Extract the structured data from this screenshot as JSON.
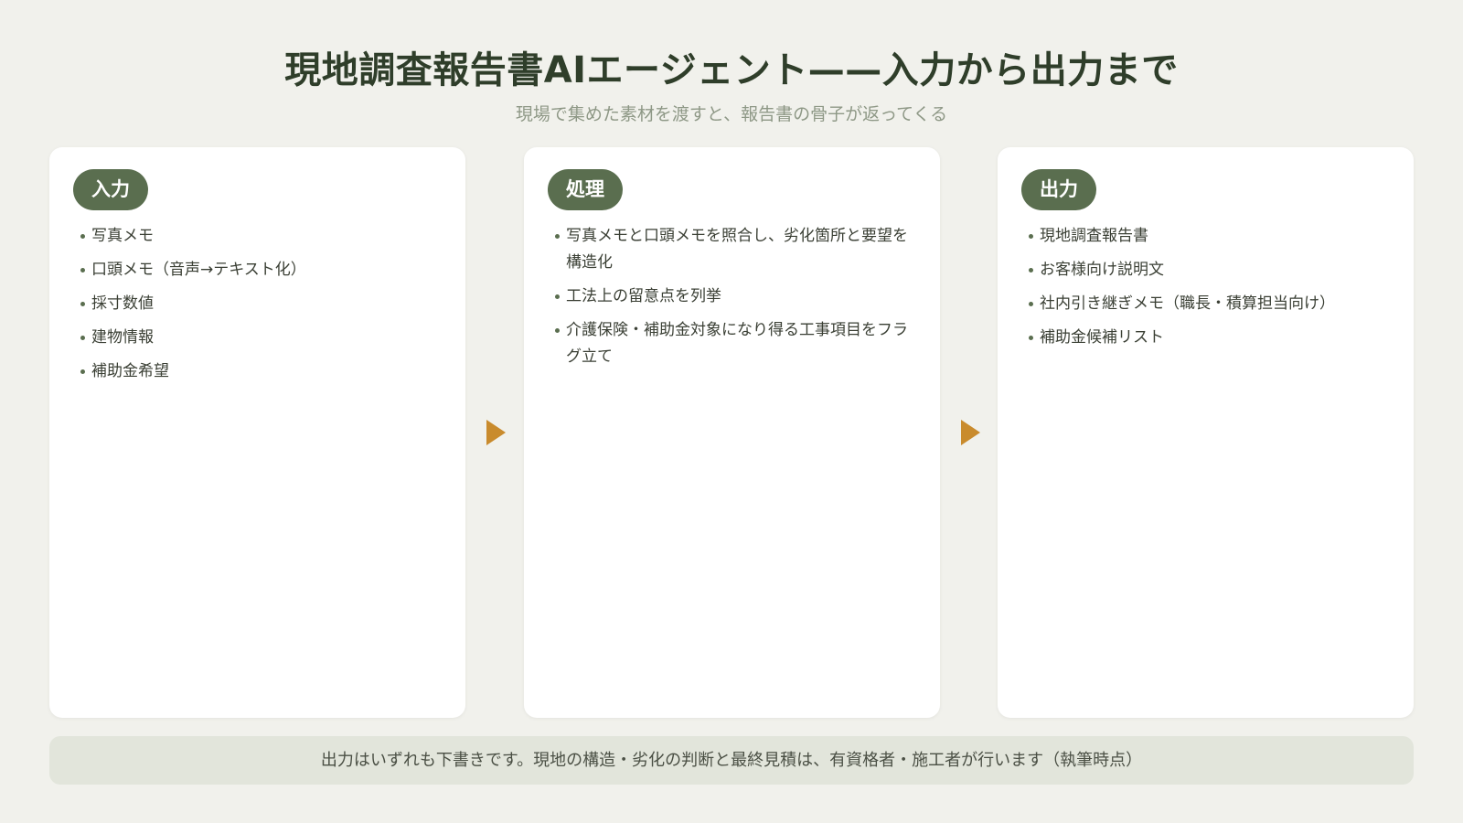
{
  "header": {
    "title": "現地調査報告書AIエージェント——入力から出力まで",
    "subtitle": "現場で集めた素材を渡すと、報告書の骨子が返ってくる"
  },
  "stages": [
    {
      "label": "入力",
      "items": [
        "写真メモ",
        "口頭メモ（音声→テキスト化）",
        "採寸数値",
        "建物情報",
        "補助金希望"
      ]
    },
    {
      "label": "処理",
      "items": [
        "写真メモと口頭メモを照合し、劣化箇所と要望を構造化",
        "工法上の留意点を列挙",
        "介護保険・補助金対象になり得る工事項目をフラグ立て"
      ]
    },
    {
      "label": "出力",
      "items": [
        "現地調査報告書",
        "お客様向け説明文",
        "社内引き継ぎメモ（職長・積算担当向け）",
        "補助金候補リスト"
      ]
    }
  ],
  "footer_note": "出力はいずれも下書きです。現地の構造・劣化の判断と最終見積は、有資格者・施工者が行います（執筆時点）",
  "colors": {
    "background": "#f1f1ec",
    "card": "#ffffff",
    "accent": "#5a6e4f",
    "arrow": "#c98b2d",
    "note_bg": "#e2e5db"
  },
  "icons": {
    "flow_arrow": "triangle-right-icon"
  }
}
